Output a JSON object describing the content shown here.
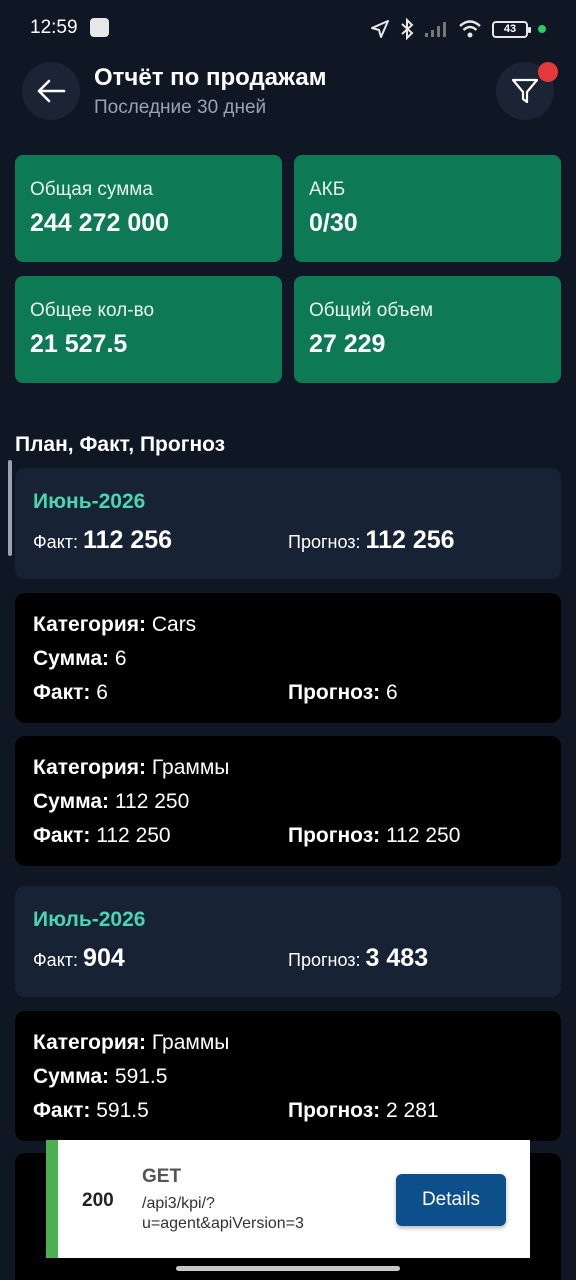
{
  "status": {
    "time": "12:59",
    "battery": "43"
  },
  "header": {
    "title": "Отчёт по продажам",
    "subtitle": "Последние 30 дней"
  },
  "stats": [
    {
      "label": "Общая сумма",
      "value": "244 272 000"
    },
    {
      "label": "АКБ",
      "value": "0/30"
    },
    {
      "label": "Общее кол-во",
      "value": "21 527.5"
    },
    {
      "label": "Общий объем",
      "value": "27 229"
    }
  ],
  "section_title": "План, Факт, Прогноз",
  "labels": {
    "fact": "Факт:",
    "forecast": "Прогноз:",
    "category": "Категория:",
    "sum": "Сумма:"
  },
  "months": [
    {
      "name": "Июнь-2026",
      "fact": "112 256",
      "forecast": "112 256"
    },
    {
      "name": "Июль-2026",
      "fact": "904",
      "forecast": "3 483"
    }
  ],
  "categories": [
    {
      "category": "Cars",
      "sum": "6",
      "fact": "6",
      "forecast": "6"
    },
    {
      "category": "Граммы",
      "sum": "112 250",
      "fact": "112 250",
      "forecast": "112 250"
    },
    {
      "category": "Граммы",
      "sum": "591.5",
      "fact": "591.5",
      "forecast": "2 281"
    }
  ],
  "toast": {
    "code": "200",
    "method": "GET",
    "url": "/api3/kpi/?u=agent&apiVersion=3",
    "button": "Details"
  },
  "colors": {
    "background": "#0f1725",
    "card_green": "#0d7a55",
    "accent_teal": "#47d6b0",
    "toast_border": "#4caf50",
    "button_blue": "#0d4f8b"
  }
}
